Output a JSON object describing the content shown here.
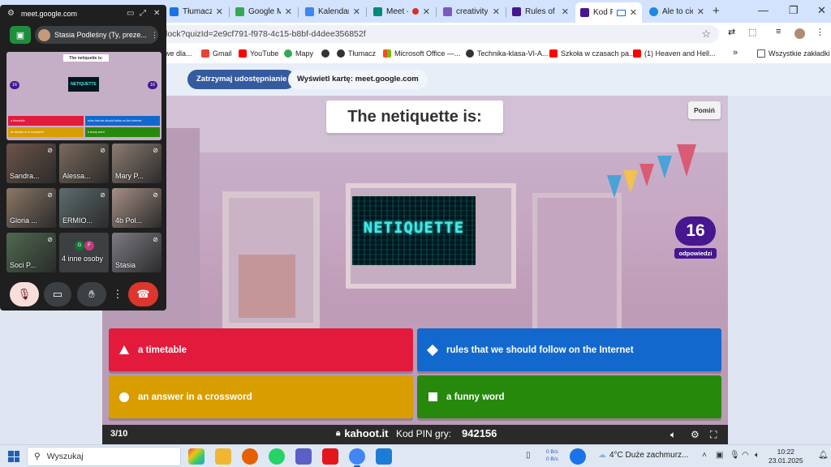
{
  "tabs": [
    {
      "label": "Tłumacz G",
      "color": "#1a73e8"
    },
    {
      "label": "Google M",
      "color": "#34a853"
    },
    {
      "label": "Kalendarz",
      "color": "#4285f4"
    },
    {
      "label": "Meet -",
      "color": "#00897b"
    },
    {
      "label": "creativity",
      "color": "#7e57c2"
    },
    {
      "label": "Rules of",
      "color": "#46178f"
    },
    {
      "label": "Kod PI",
      "color": "#46178f"
    },
    {
      "label": "Ale to cie",
      "color": "#1e88e5"
    }
  ],
  "address_bar": {
    "url": "lock?quizId=2e9cf791-f978-4c15-b8bf-d4dee356852f"
  },
  "bookmarks": {
    "items": [
      {
        "label": "we dla...",
        "color": "#888888"
      },
      {
        "label": "Gmail",
        "color": "#ea4335"
      },
      {
        "label": "YouTube",
        "color": "#ff0000"
      },
      {
        "label": "Mapy",
        "color": "#34a853"
      },
      {
        "label": "Tłumacz",
        "color": "#1a73e8"
      },
      {
        "label": "Microsoft Office —...",
        "color": "#f25022"
      },
      {
        "label": "Technika-klasa-VI-A...",
        "color": "#333333"
      },
      {
        "label": "Szkoła w czasach pa...",
        "color": "#ff0000"
      },
      {
        "label": "(1) Heaven and Hell...",
        "color": "#ff0000"
      }
    ],
    "all_bookmarks": "Wszystkie zakładki"
  },
  "share_bar": {
    "stop_label": "Zatrzymaj udostępnianie",
    "show_label": "Wyświetl kartę: meet.google.com"
  },
  "meet": {
    "url": "meet.google.com",
    "user": "Stasia Podleśny (Ty, preze...",
    "preview_title": "The netiquette is:",
    "preview_image": "NETIQUETTE",
    "preview_badge": "16",
    "preview_answers": [
      "a timetable",
      "rules that we should follow on the Internet",
      "an answer in a crossword",
      "a funny word"
    ],
    "participants": [
      {
        "name": "Sandra...",
        "bg": "#6d5448"
      },
      {
        "name": "Alessa...",
        "bg": "#7a6a5c"
      },
      {
        "name": "Mary P...",
        "bg": "#8b7c72"
      },
      {
        "name": "Gloria ...",
        "bg": "#8a7866"
      },
      {
        "name": "ERMIO...",
        "bg": "#5d6c6e"
      },
      {
        "name": "4b Pol...",
        "bg": "#a58f86"
      },
      {
        "name": "Soci P...",
        "bg": "#4f6a4e"
      },
      {
        "name": "Stasia",
        "bg": "#7d7b84"
      }
    ],
    "others_label": "4 inne osoby",
    "others_initials": [
      {
        "letter": "G",
        "color": "#137333"
      },
      {
        "letter": "F",
        "color": "#c5397b"
      }
    ]
  },
  "kahoot": {
    "question": "The netiquette is:",
    "skip_label": "Pomiń",
    "image_text": "NETIQUETTE",
    "answers_count": "16",
    "answers_label": "odpowiedzi",
    "answers": [
      {
        "text": "a timetable",
        "shape": "triangle",
        "color": "#e21b3c"
      },
      {
        "text": "rules that we should follow on the Internet",
        "shape": "diamond",
        "color": "#1368ce"
      },
      {
        "text": "an answer in a crossword",
        "shape": "circle",
        "color": "#d89e00"
      },
      {
        "text": "a funny word",
        "shape": "square",
        "color": "#26890c"
      }
    ],
    "footer": {
      "progress": "3/10",
      "site": "kahoot.it",
      "pin_label": "Kod PIN gry:",
      "pin": "942156"
    }
  },
  "taskbar": {
    "search_placeholder": "Wyszukaj",
    "net_up": "0 B/s",
    "net_down": "0 B/s",
    "weather": "4°C  Duże zachmurz...",
    "time": "10:22",
    "date": "23.01.2025"
  }
}
